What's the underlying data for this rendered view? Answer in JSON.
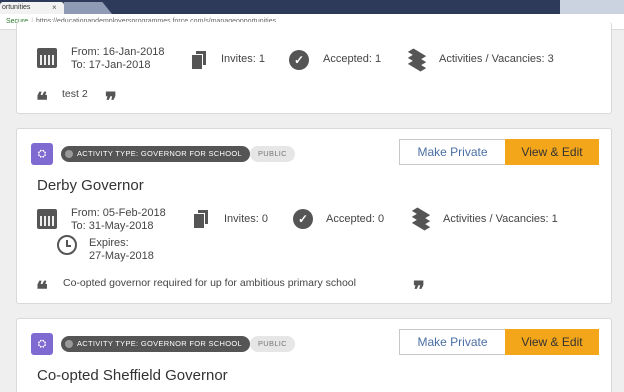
{
  "browser": {
    "tab_title": "ortunities",
    "tab_close": "×",
    "secure_label": "Secure",
    "url": "https://educationandemployersprogrammes.force.com/s/manageopportunities"
  },
  "cards": [
    {
      "from": "From: 16-Jan-2018",
      "to": "To: 17-Jan-2018",
      "invites": "Invites: 1",
      "accepted": "Accepted: 1",
      "activities": "Activities / Vacancies: 3",
      "description": "test 2"
    },
    {
      "activity_type": "ACTIVITY TYPE: GOVERNOR FOR SCHOOL",
      "visibility": "PUBLIC",
      "make_private": "Make Private",
      "view_edit": "View & Edit",
      "title": "Derby Governor",
      "from": "From: 05-Feb-2018",
      "to": "To: 31-May-2018",
      "expires_label": "Expires:",
      "expires_date": "27-May-2018",
      "invites": "Invites: 0",
      "accepted": "Accepted: 0",
      "activities": "Activities / Vacancies: 1",
      "description": "Co-opted governor required for up for ambitious primary school"
    },
    {
      "activity_type": "ACTIVITY TYPE: GOVERNOR FOR SCHOOL",
      "visibility": "PUBLIC",
      "make_private": "Make Private",
      "view_edit": "View & Edit",
      "title": "Co-opted Sheffield Governor"
    }
  ],
  "icons": {
    "quote_open": "❝",
    "quote_close": "❞",
    "check": "✓",
    "type": "⛭"
  },
  "colors": {
    "accent": "#f4a61a",
    "type_icon": "#7e6ad0",
    "link": "#4a6fa5"
  }
}
